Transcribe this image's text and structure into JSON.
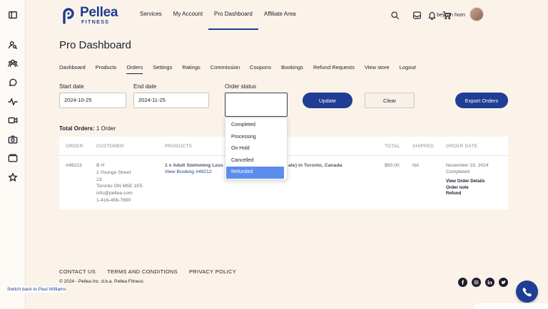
{
  "header": {
    "logo_name": "Pellea",
    "logo_sub": "FITNESS",
    "nav": [
      "Services",
      "My Account",
      "Pro Dashboard",
      "Affiliate Area"
    ],
    "active_nav": "Pro Dashboard",
    "user_name": "beyorn horn"
  },
  "page": {
    "title": "Pro Dashboard",
    "tabs": [
      "Dashboard",
      "Products",
      "Orders",
      "Settings",
      "Ratings",
      "Commission",
      "Coupons",
      "Bookings",
      "Refund Requests",
      "View store",
      "Logout"
    ],
    "active_tab": "Orders"
  },
  "filters": {
    "start_label": "Start date",
    "start_value": "2024-10-25",
    "end_label": "End date",
    "end_value": "2024-11-25",
    "status_label": "Order status",
    "update_label": "Update",
    "clear_label": "Clear",
    "export_label": "Export Orders"
  },
  "status_options": [
    "Completed",
    "Processing",
    "On Hold",
    "Cancelled",
    "Refunded"
  ],
  "status_highlighted": "Refunded",
  "total": {
    "label": "Total Orders:",
    "value": "1 Order"
  },
  "table": {
    "headers": {
      "order": "ORDER",
      "customer": "CUSTOMER",
      "products": "PRODUCTS",
      "total": "TOTAL",
      "shipped": "SHIPPED",
      "order_date": "ORDER DATE"
    },
    "rows": [
      {
        "order": "#49213",
        "customer": [
          "B H",
          "1 Younge Street",
          "13",
          "Toronto ON M5E 1E5",
          "info@pellea.com",
          "1-416-456-7890"
        ],
        "product_visible": "1 x Adult Swimming Less",
        "product_tail": "ate) in Toronto, Canada",
        "booking_link": "View Booking #49212",
        "total": "$50.00",
        "shipped": "NA",
        "date": "November 19, 2024",
        "status": "Completed",
        "actions": [
          "View Order Details",
          "Order note",
          "Refund"
        ]
      }
    ]
  },
  "footer": {
    "links": [
      "CONTACT US",
      "TERMS AND CONDITIONS",
      "PRIVACY POLICY"
    ],
    "copyright": "© 2024 - Pellea Inc. d.b.a. Pellea Fitness",
    "switch_back": "Switch back to Paul Williams"
  },
  "colors": {
    "brand": "#1f3d94",
    "page_bg": "#fbf3ea",
    "dropdown_highlight": "#5b8def"
  },
  "icons": {
    "rail": [
      "sidebar-toggle-icon",
      "user-search-icon",
      "users-icon",
      "chat-icon",
      "activity-icon",
      "video-icon",
      "camera-icon",
      "folder-icon",
      "star-icon"
    ],
    "header": [
      "search-icon",
      "inbox-icon",
      "bell-icon",
      "cart-icon"
    ],
    "social": [
      "facebook-icon",
      "instagram-icon",
      "linkedin-icon",
      "twitter-icon"
    ]
  }
}
